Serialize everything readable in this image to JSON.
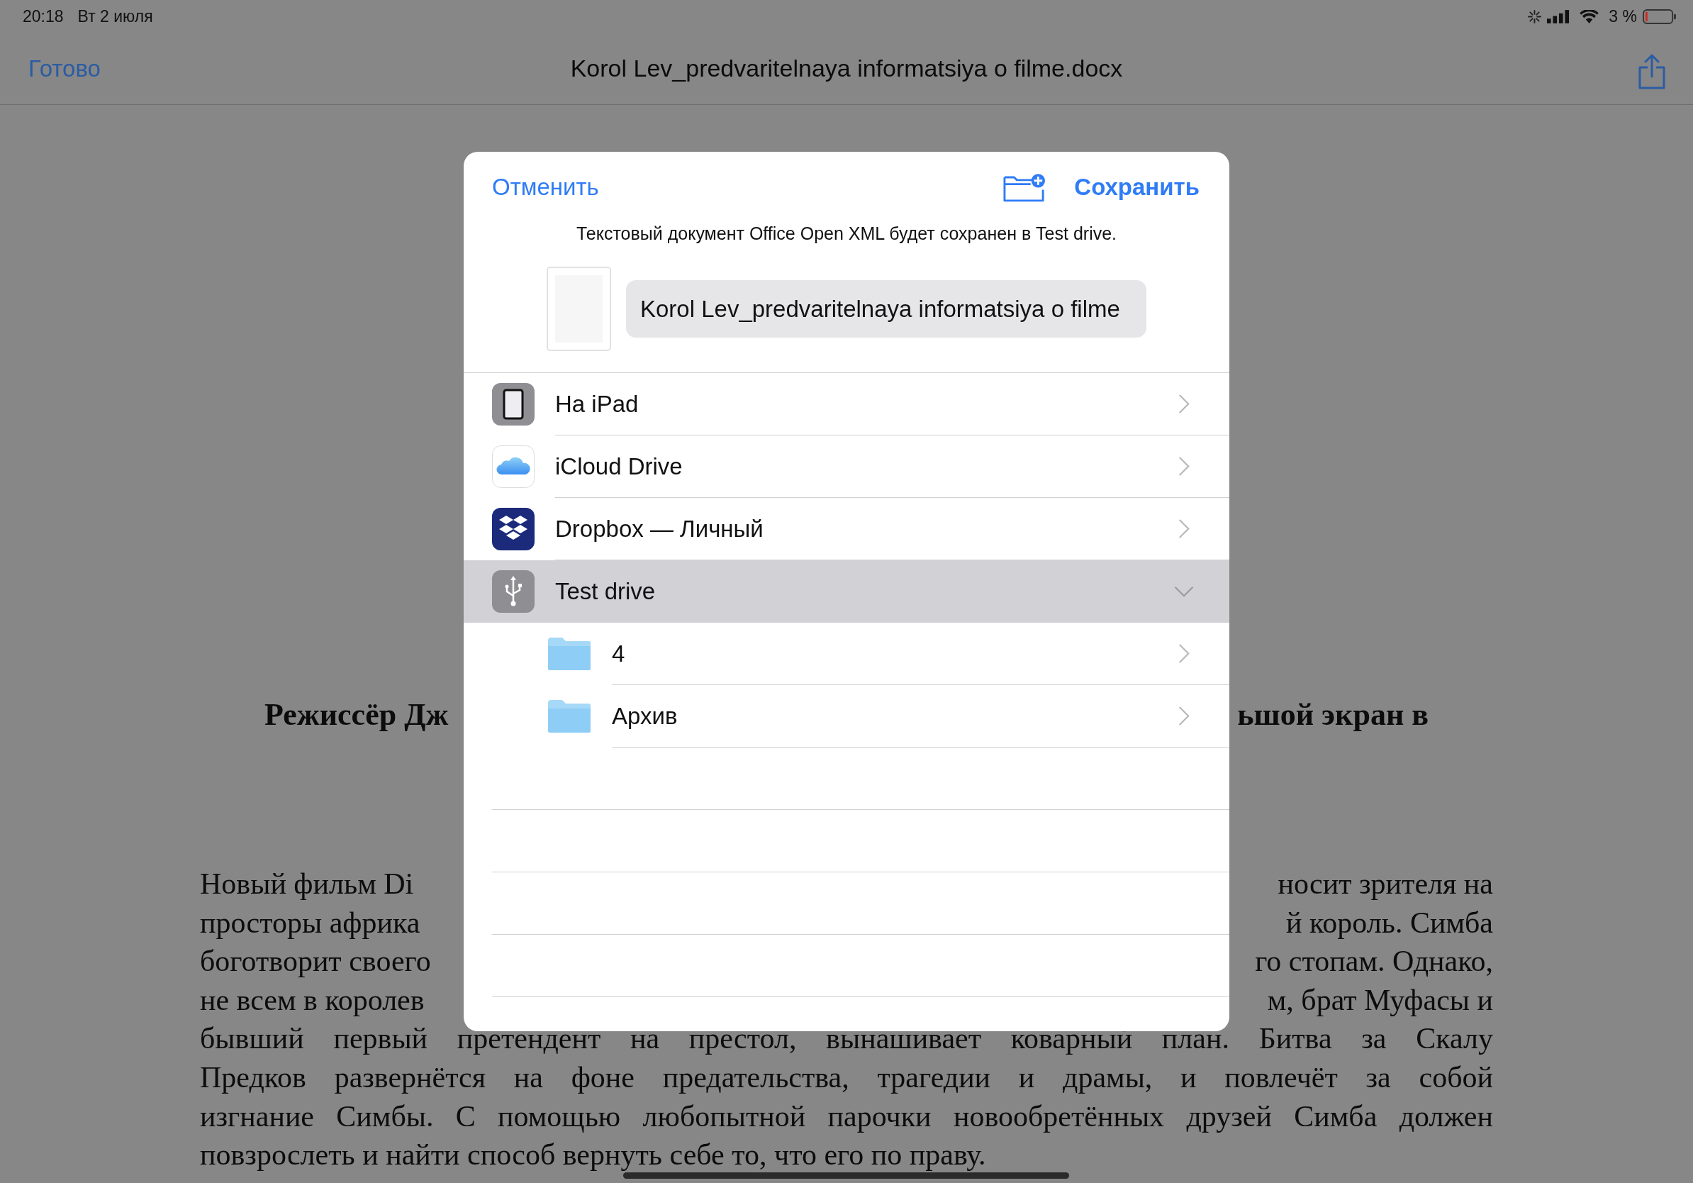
{
  "status_bar": {
    "time": "20:18",
    "date": "Вт 2 июля",
    "battery_percent": "3 %"
  },
  "nav_bar": {
    "done_button": "Готово",
    "title": "Korol Lev_predvaritelnaya informatsiya o filme.docx"
  },
  "document": {
    "heading": {
      "left": "Режиссёр Дж",
      "right": "ьшой экран в"
    },
    "lines": [
      {
        "kind": "split",
        "left": "Новый фильм Di",
        "right": "носит зрителя на"
      },
      {
        "kind": "split",
        "left": "просторы африка",
        "right": "й король. Симба"
      },
      {
        "kind": "split",
        "left": "боготворит своего",
        "right": "го стопам. Однако,"
      },
      {
        "kind": "split",
        "left": "не всем в королев",
        "right": "м, брат Муфасы и"
      },
      {
        "kind": "justified",
        "text": "бывший первый претендент на престол, вынашивает коварный план. Битва за Скалу"
      },
      {
        "kind": "justified",
        "text": "Предков развернётся на фоне предательства, трагедии и драмы, и повлечёт за собой"
      },
      {
        "kind": "justified",
        "text": "изгнание Симбы. С помощью любопытной парочки новообретённых друзей Симба должен"
      },
      {
        "kind": "ragged",
        "text": "повзрослеть и найти способ вернуть себе то, что его по праву."
      }
    ]
  },
  "save_dialog": {
    "cancel_button": "Отменить",
    "save_button": "Сохранить",
    "message": "Текстовый документ Office Open XML будет сохранен в Test drive.",
    "file_name": "Korol Lev_predvaritelnaya informatsiya o filme",
    "locations": [
      {
        "kind": "ipad",
        "name": "На iPad",
        "selected": false,
        "expanded": false
      },
      {
        "kind": "icloud",
        "name": "iCloud Drive",
        "selected": false,
        "expanded": false
      },
      {
        "kind": "dropbox",
        "name": "Dropbox — Личный",
        "selected": false,
        "expanded": false
      },
      {
        "kind": "usb",
        "name": "Test drive",
        "selected": true,
        "expanded": true,
        "children": [
          {
            "name": "4"
          },
          {
            "name": "Архив"
          }
        ]
      }
    ]
  }
}
